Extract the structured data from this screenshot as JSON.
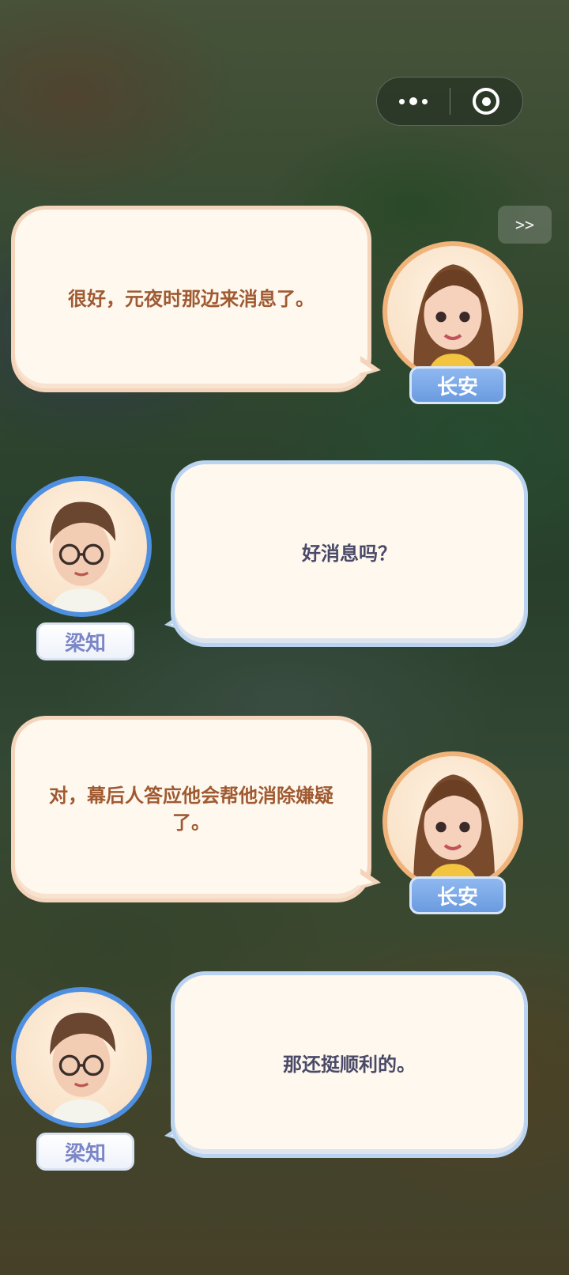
{
  "capsule": {
    "more_icon": "more-dots-icon",
    "close_icon": "target-close-icon"
  },
  "skip": {
    "label": ">>"
  },
  "dialogue": [
    {
      "speaker": "长安",
      "side": "left-bubble",
      "text": "很好，元夜时那边来消息了。"
    },
    {
      "speaker": "梁知",
      "side": "right-bubble",
      "text": "好消息吗？"
    },
    {
      "speaker": "长安",
      "side": "left-bubble",
      "text": "对，幕后人答应他会帮他消除嫌疑了。"
    },
    {
      "speaker": "梁知",
      "side": "right-bubble",
      "text": "那还挺顺利的。"
    }
  ],
  "colors": {
    "female_ring": "#f0b37a",
    "male_ring": "#4f8fe0",
    "female_text": "#a05a32",
    "male_text": "#4a4a68"
  }
}
